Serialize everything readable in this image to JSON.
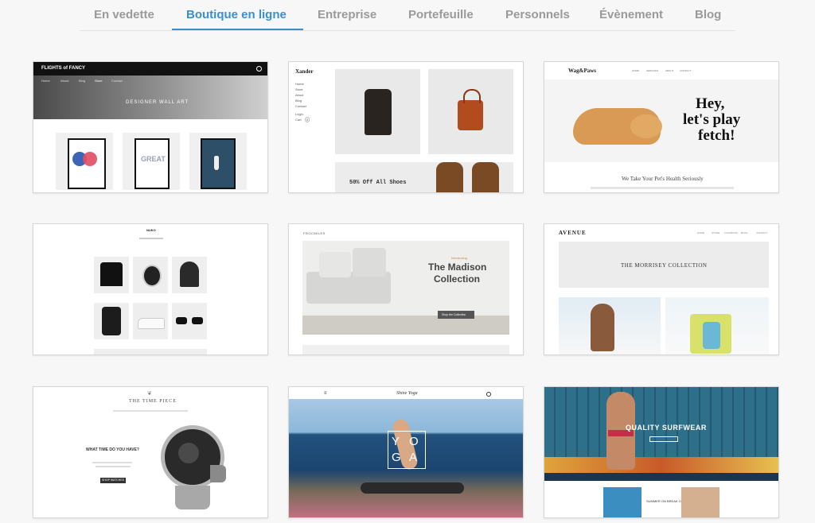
{
  "tabs": [
    {
      "label": "En vedette"
    },
    {
      "label": "Boutique en ligne"
    },
    {
      "label": "Entreprise"
    },
    {
      "label": "Portefeuille"
    },
    {
      "label": "Personnels"
    },
    {
      "label": "Évènement"
    },
    {
      "label": "Blog"
    }
  ],
  "active_tab": "Boutique en ligne",
  "colors": {
    "accent": "#3a8fd0",
    "tab_text": "#9a9a9a"
  },
  "templates": {
    "flights": {
      "brand": "FLIGHTS of FANCY",
      "nav": [
        "Home",
        "About",
        "Blog",
        "Store",
        "Contact"
      ],
      "hero": "DESIGNER WALL ART",
      "art3": "GREAT"
    },
    "xander": {
      "brand": "Xander",
      "nav": [
        "Home",
        "Store",
        "About",
        "Blog",
        "Contact"
      ],
      "login": "Login",
      "cart": "Cart",
      "cart_count": "0",
      "promo": "50% Off All Shoes"
    },
    "wag": {
      "brand": "Wag&Paws",
      "nav": [
        "HOME",
        "SERVICES",
        "ABOUT",
        "CONTACT"
      ],
      "headline1": "Hey,",
      "headline2": "let's play",
      "headline3": "fetch!",
      "tagline": "We Take Your Pet's Health Seriously"
    },
    "nuko": {
      "brand": "NUKO"
    },
    "frocmiles": {
      "brand": "FROCMILES",
      "kicker": "Introducing",
      "title1": "The Madison",
      "title2": "Collection",
      "button": "Shop the Collection"
    },
    "avenue": {
      "brand": "AVENUE",
      "nav": [
        "HOME",
        "STORE",
        "LOOKBOOK",
        "BLOG",
        "CONTACT"
      ],
      "banner": "THE MORRISEY COLLECTION"
    },
    "timepiece": {
      "brand": "THE TIME PIECE",
      "question": "WHAT TIME DO YOU HAVE?",
      "button": "SHOP WATCHES"
    },
    "yoga": {
      "brand": "Shine Yoga",
      "letters": [
        "Y",
        "O",
        "G",
        "A"
      ]
    },
    "surf": {
      "headline": "QUALITY SURFWEAR",
      "promo": "SUMMER ON BREAK ON"
    }
  }
}
